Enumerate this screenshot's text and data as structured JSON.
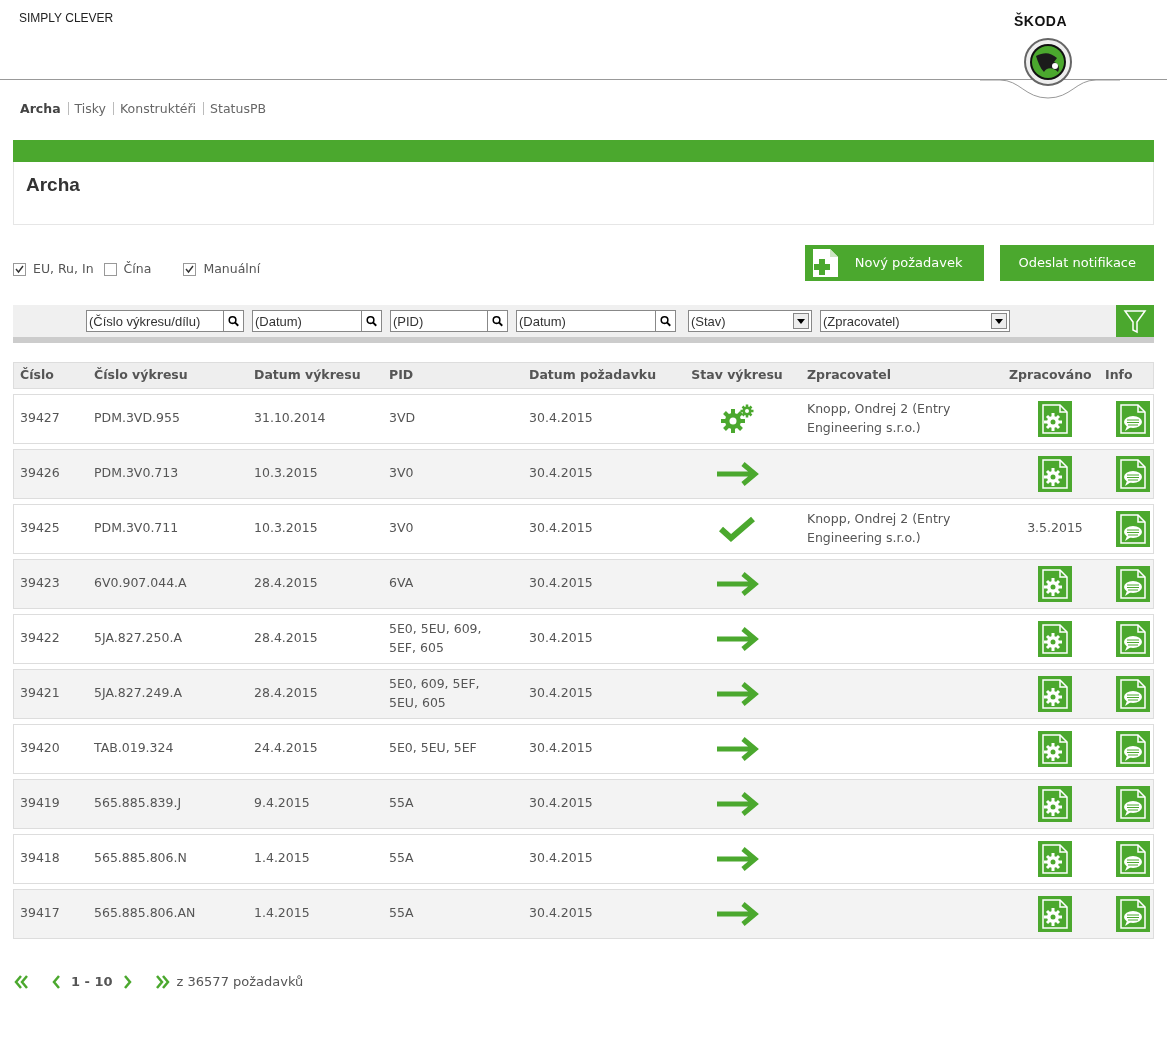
{
  "header": {
    "slogan": "SIMPLY CLEVER",
    "brand": "ŠKODA"
  },
  "nav": [
    {
      "label": "Archa",
      "selected": true
    },
    {
      "label": "Tisky",
      "selected": false
    },
    {
      "label": "Konstruktéři",
      "selected": false
    },
    {
      "label": "StatusPB",
      "selected": false
    }
  ],
  "panel_title": "Archa",
  "checkboxes": [
    {
      "label": "EU, Ru, In",
      "checked": true
    },
    {
      "label": "Čína",
      "checked": false
    },
    {
      "label": "Manuální",
      "checked": true
    }
  ],
  "buttons": [
    {
      "label": "Nový požadavek",
      "kind": "icon"
    },
    {
      "label": "Odeslat notifikace",
      "kind": "plain"
    }
  ],
  "filters": [
    {
      "placeholder": "(Číslo výkresu/dílu)",
      "kind": "search"
    },
    {
      "placeholder": "(Datum)",
      "kind": "search"
    },
    {
      "placeholder": "(PID)",
      "kind": "search"
    },
    {
      "placeholder": "(Datum)",
      "kind": "search"
    },
    {
      "placeholder": "(Stav)",
      "kind": "select"
    },
    {
      "placeholder": "(Zpracovatel)",
      "kind": "select"
    }
  ],
  "table": {
    "columns": [
      "Číslo",
      "Číslo výkresu",
      "Datum výkresu",
      "PID",
      "Datum požadavku",
      "Stav výkresu",
      "Zpracovatel",
      "Zpracováno",
      "Info"
    ],
    "rows": [
      {
        "cislo": "39427",
        "vykres": "PDM.3VD.955",
        "datum_vykresu": "31.10.2014",
        "pid": "3VD",
        "datum_pozadavku": "30.4.2015",
        "kind": "gears",
        "zpracovatel": "Knopp, Ondrej 2 (Entry Engineering s.r.o.)",
        "zpracovano": ""
      },
      {
        "cislo": "39426",
        "vykres": "PDM.3V0.713",
        "datum_vykresu": "10.3.2015",
        "pid": "3V0",
        "datum_pozadavku": "30.4.2015",
        "kind": "arrow",
        "zpracovatel": "",
        "zpracovano": ""
      },
      {
        "cislo": "39425",
        "vykres": "PDM.3V0.711",
        "datum_vykresu": "10.3.2015",
        "pid": "3V0",
        "datum_pozadavku": "30.4.2015",
        "kind": "check",
        "zpracovatel": "Knopp, Ondrej 2 (Entry Engineering s.r.o.)",
        "zpracovano": "3.5.2015"
      },
      {
        "cislo": "39423",
        "vykres": "6V0.907.044.A",
        "datum_vykresu": "28.4.2015",
        "pid": "6VA",
        "datum_pozadavku": "30.4.2015",
        "kind": "arrow",
        "zpracovatel": "",
        "zpracovano": ""
      },
      {
        "cislo": "39422",
        "vykres": "5JA.827.250.A",
        "datum_vykresu": "28.4.2015",
        "pid": "5E0, 5EU, 609, 5EF, 605",
        "datum_pozadavku": "30.4.2015",
        "kind": "arrow",
        "zpracovatel": "",
        "zpracovano": ""
      },
      {
        "cislo": "39421",
        "vykres": "5JA.827.249.A",
        "datum_vykresu": "28.4.2015",
        "pid": "5E0, 609, 5EF, 5EU, 605",
        "datum_pozadavku": "30.4.2015",
        "kind": "arrow",
        "zpracovatel": "",
        "zpracovano": ""
      },
      {
        "cislo": "39420",
        "vykres": "TAB.019.324",
        "datum_vykresu": "24.4.2015",
        "pid": "5E0, 5EU, 5EF",
        "datum_pozadavku": "30.4.2015",
        "kind": "arrow",
        "zpracovatel": "",
        "zpracovano": ""
      },
      {
        "cislo": "39419",
        "vykres": "565.885.839.J",
        "datum_vykresu": "9.4.2015",
        "pid": "55A",
        "datum_pozadavku": "30.4.2015",
        "kind": "arrow",
        "zpracovatel": "",
        "zpracovano": ""
      },
      {
        "cislo": "39418",
        "vykres": "565.885.806.N",
        "datum_vykresu": "1.4.2015",
        "pid": "55A",
        "datum_pozadavku": "30.4.2015",
        "kind": "arrow",
        "zpracovatel": "",
        "zpracovano": ""
      },
      {
        "cislo": "39417",
        "vykres": "565.885.806.AN",
        "datum_vykresu": "1.4.2015",
        "pid": "55A",
        "datum_pozadavku": "30.4.2015",
        "kind": "arrow",
        "zpracovatel": "",
        "zpracovano": ""
      }
    ]
  },
  "pager": {
    "range": "1 - 10",
    "total": "z 36577 požadavků"
  }
}
